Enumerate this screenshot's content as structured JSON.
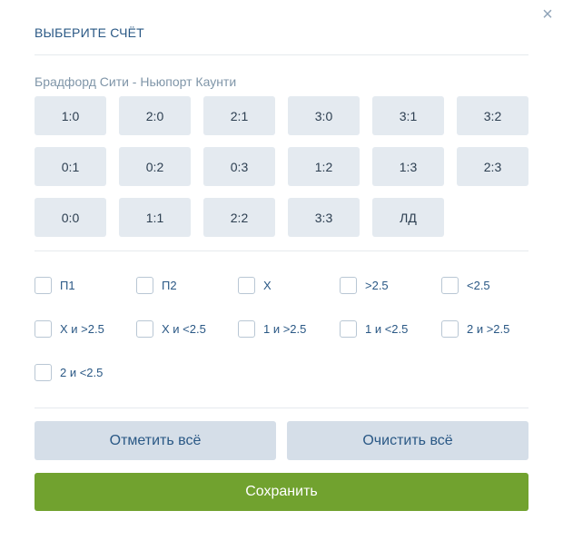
{
  "dialog": {
    "title": "ВЫБЕРИТЕ СЧЁТ",
    "close_icon": "close-icon",
    "close_glyph": "×"
  },
  "match": "Брадфорд Сити - Ньюпорт Каунти",
  "scores": [
    "1:0",
    "2:0",
    "2:1",
    "3:0",
    "3:1",
    "3:2",
    "0:1",
    "0:2",
    "0:3",
    "1:2",
    "1:3",
    "2:3",
    "0:0",
    "1:1",
    "2:2",
    "3:3",
    "ЛД"
  ],
  "outcomes": [
    {
      "label": "П1",
      "checked": false
    },
    {
      "label": "П2",
      "checked": false
    },
    {
      "label": "X",
      "checked": false
    },
    {
      "label": ">2.5",
      "checked": false
    },
    {
      "label": "<2.5",
      "checked": false
    },
    {
      "label": "X и >2.5",
      "checked": false
    },
    {
      "label": "X и <2.5",
      "checked": false
    },
    {
      "label": "1 и >2.5",
      "checked": false
    },
    {
      "label": "1 и <2.5",
      "checked": false
    },
    {
      "label": "2 и >2.5",
      "checked": false
    },
    {
      "label": "2 и <2.5",
      "checked": false
    }
  ],
  "buttons": {
    "select_all": "Отметить всё",
    "clear_all": "Очистить всё",
    "save": "Сохранить"
  },
  "colors": {
    "title": "#2a5885",
    "score_bg": "#e4eaf0",
    "action_bg": "#d5dee8",
    "save_bg": "#71a22f"
  }
}
